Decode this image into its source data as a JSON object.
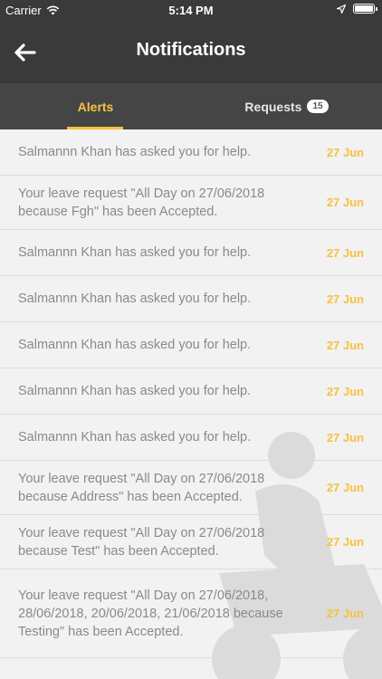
{
  "status_bar": {
    "carrier": "Carrier",
    "time": "5:14 PM"
  },
  "header": {
    "title": "Notifications"
  },
  "tabs": [
    {
      "label": "Alerts",
      "active": true
    },
    {
      "label": "Requests",
      "badge": "15"
    }
  ],
  "notifications": [
    {
      "text": "Salmannn Khan has asked you for help.",
      "date": "27 Jun"
    },
    {
      "text": "Your leave request \"All Day on 27/06/2018 because Fgh\" has been Accepted.",
      "date": "27 Jun"
    },
    {
      "text": "Salmannn Khan has asked you for help.",
      "date": "27 Jun"
    },
    {
      "text": "Salmannn Khan has asked you for help.",
      "date": "27 Jun"
    },
    {
      "text": "Salmannn Khan has asked you for help.",
      "date": "27 Jun"
    },
    {
      "text": "Salmannn Khan has asked you for help.",
      "date": "27 Jun"
    },
    {
      "text": "Salmannn Khan has asked you for help.",
      "date": "27 Jun"
    },
    {
      "text": "Your leave request \"All Day on 27/06/2018 because Address\" has been Accepted.",
      "date": "27 Jun"
    },
    {
      "text": "Your leave request \"All Day on 27/06/2018 because Test\" has been Accepted.",
      "date": "27 Jun"
    },
    {
      "text": "Your leave request \"All Day on 27/06/2018, 28/06/2018, 20/06/2018, 21/06/2018 because Testing\" has been Accepted.",
      "date": "27 Jun"
    }
  ],
  "colors": {
    "accent": "#f6c23e",
    "header_bg": "#3a3a3a",
    "tabs_bg": "#454545",
    "list_bg": "#f2f2f2"
  }
}
